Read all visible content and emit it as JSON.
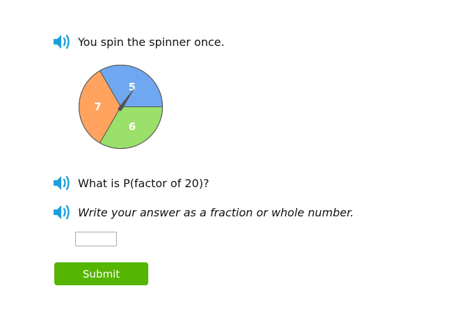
{
  "intro": {
    "text": "You spin the spinner once."
  },
  "spinner": {
    "sections": [
      {
        "label": "5",
        "color": "#6fa8f0",
        "start_deg": 0,
        "end_deg": 120
      },
      {
        "label": "7",
        "color": "#ffa35f",
        "start_deg": 120,
        "end_deg": 240
      },
      {
        "label": "6",
        "color": "#9be06a",
        "start_deg": 240,
        "end_deg": 360
      }
    ],
    "outline_color": "#555555",
    "needle_color": "#555555"
  },
  "question": {
    "text": "What is P(factor of 20)?"
  },
  "instruction": {
    "text": "Write your answer as a fraction or whole number."
  },
  "answer": {
    "value": "",
    "placeholder": ""
  },
  "submit": {
    "label": "Submit",
    "color": "#56b500"
  },
  "icons": {
    "speaker": "speaker-icon",
    "speaker_color": "#1e9fdc"
  }
}
